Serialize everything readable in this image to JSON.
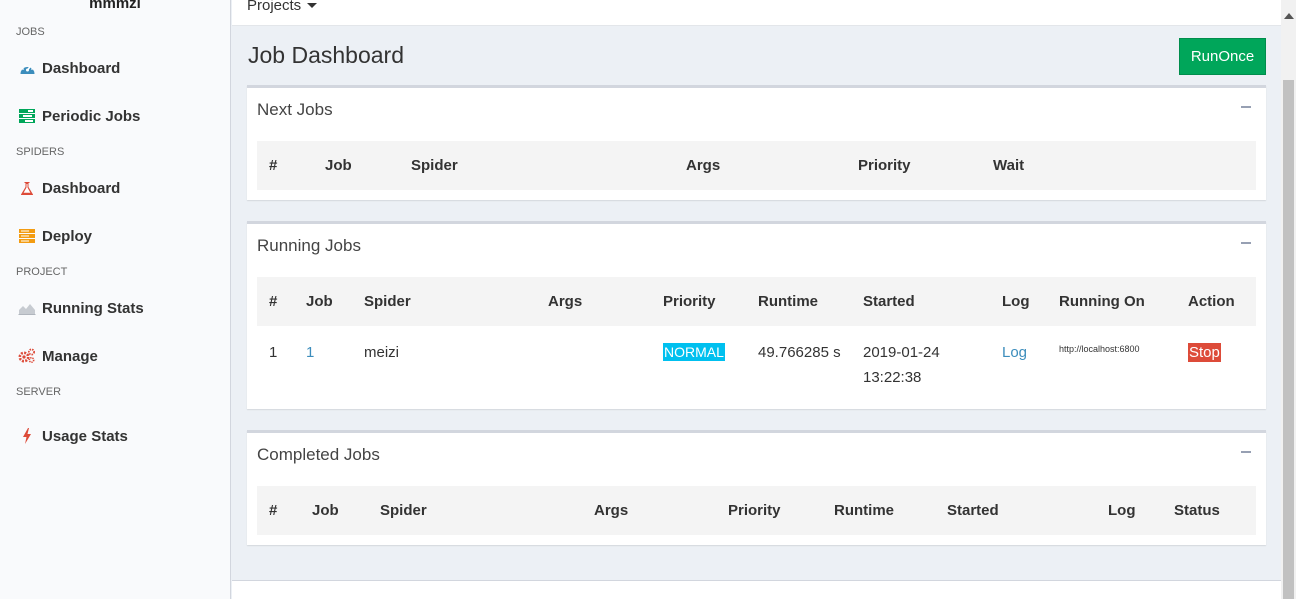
{
  "sidebar": {
    "brand": "mmmzi",
    "sections": [
      {
        "header": "JOBS",
        "items": [
          {
            "label": "Dashboard",
            "icon": "dashboard-icon"
          },
          {
            "label": "Periodic Jobs",
            "icon": "tasks-icon"
          }
        ]
      },
      {
        "header": "SPIDERS",
        "items": [
          {
            "label": "Dashboard",
            "icon": "flask-icon"
          },
          {
            "label": "Deploy",
            "icon": "server-icon"
          }
        ]
      },
      {
        "header": "PROJECT",
        "items": [
          {
            "label": "Running Stats",
            "icon": "area-chart-icon"
          },
          {
            "label": "Manage",
            "icon": "cogs-icon"
          }
        ]
      },
      {
        "header": "SERVER",
        "items": [
          {
            "label": "Usage Stats",
            "icon": "bolt-icon"
          }
        ]
      }
    ]
  },
  "topbar": {
    "projects_label": "Projects"
  },
  "page": {
    "title": "Job Dashboard",
    "runonce_label": "RunOnce"
  },
  "next_jobs": {
    "title": "Next Jobs",
    "columns": [
      "#",
      "Job",
      "Spider",
      "Args",
      "Priority",
      "Wait"
    ]
  },
  "running_jobs": {
    "title": "Running Jobs",
    "columns": [
      "#",
      "Job",
      "Spider",
      "Args",
      "Priority",
      "Runtime",
      "Started",
      "Log",
      "Running On",
      "Action"
    ],
    "rows": [
      {
        "num": "1",
        "job": "1",
        "spider": "meizi",
        "args": "",
        "priority": "NORMAL",
        "runtime": "49.766285 s",
        "started_date": "2019-01-24",
        "started_time": "13:22:38",
        "log": "Log",
        "running_on": "http://localhost:6800",
        "action": "Stop"
      }
    ]
  },
  "completed_jobs": {
    "title": "Completed Jobs",
    "columns": [
      "#",
      "Job",
      "Spider",
      "Args",
      "Priority",
      "Runtime",
      "Started",
      "Log",
      "Status"
    ]
  },
  "colors": {
    "accent_green": "#00a65a",
    "link_blue": "#3c8dbc",
    "badge_info": "#00c0ef",
    "badge_danger": "#dd4b39"
  }
}
